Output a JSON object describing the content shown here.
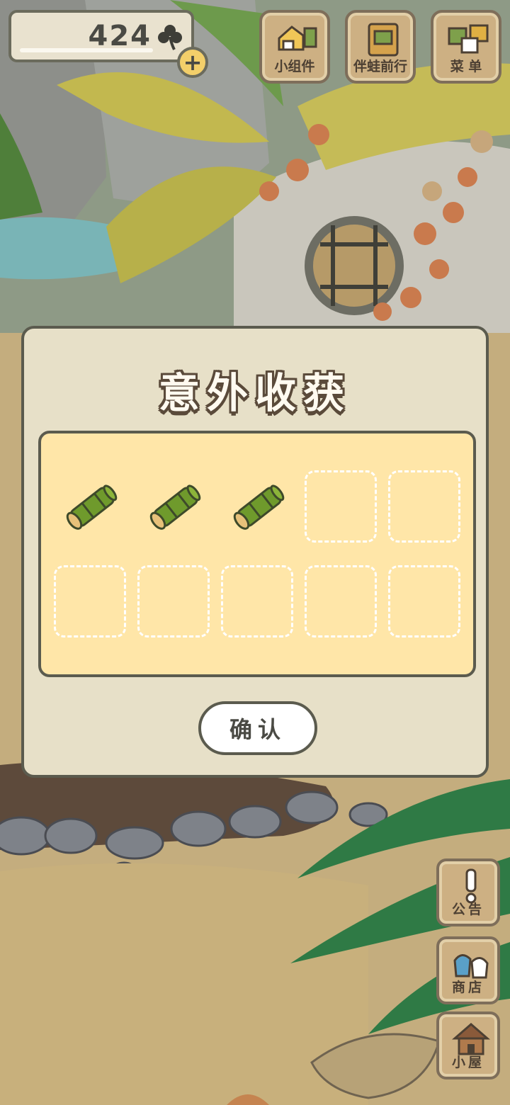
{
  "header": {
    "clover_count": "424",
    "clover_icon": "clover-icon",
    "plus_label": "+",
    "buttons": [
      {
        "label": "小组件",
        "icon": "widget-icon"
      },
      {
        "label": "伴蛙前行",
        "icon": "travel-journal-icon"
      },
      {
        "label": "菜 单",
        "icon": "menu-cards-icon"
      }
    ]
  },
  "side_buttons": [
    {
      "label": "公告",
      "icon": "exclamation-icon"
    },
    {
      "label": "商店",
      "icon": "shop-bags-icon"
    },
    {
      "label": "小屋",
      "icon": "house-icon"
    }
  ],
  "dialog": {
    "title": "意外收获",
    "slots": [
      {
        "item": "bamboo-icon"
      },
      {
        "item": "bamboo-icon"
      },
      {
        "item": "bamboo-icon"
      },
      {
        "item": null
      },
      {
        "item": null
      },
      {
        "item": null
      },
      {
        "item": null
      },
      {
        "item": null
      },
      {
        "item": null
      },
      {
        "item": null
      }
    ],
    "confirm_label": "确认"
  },
  "colors": {
    "panel": "#e7e0c8",
    "grid": "#ffe6a8",
    "outline": "#5b5b4e",
    "wood": "#cdb083",
    "bamboo": "#6f9a2c"
  }
}
